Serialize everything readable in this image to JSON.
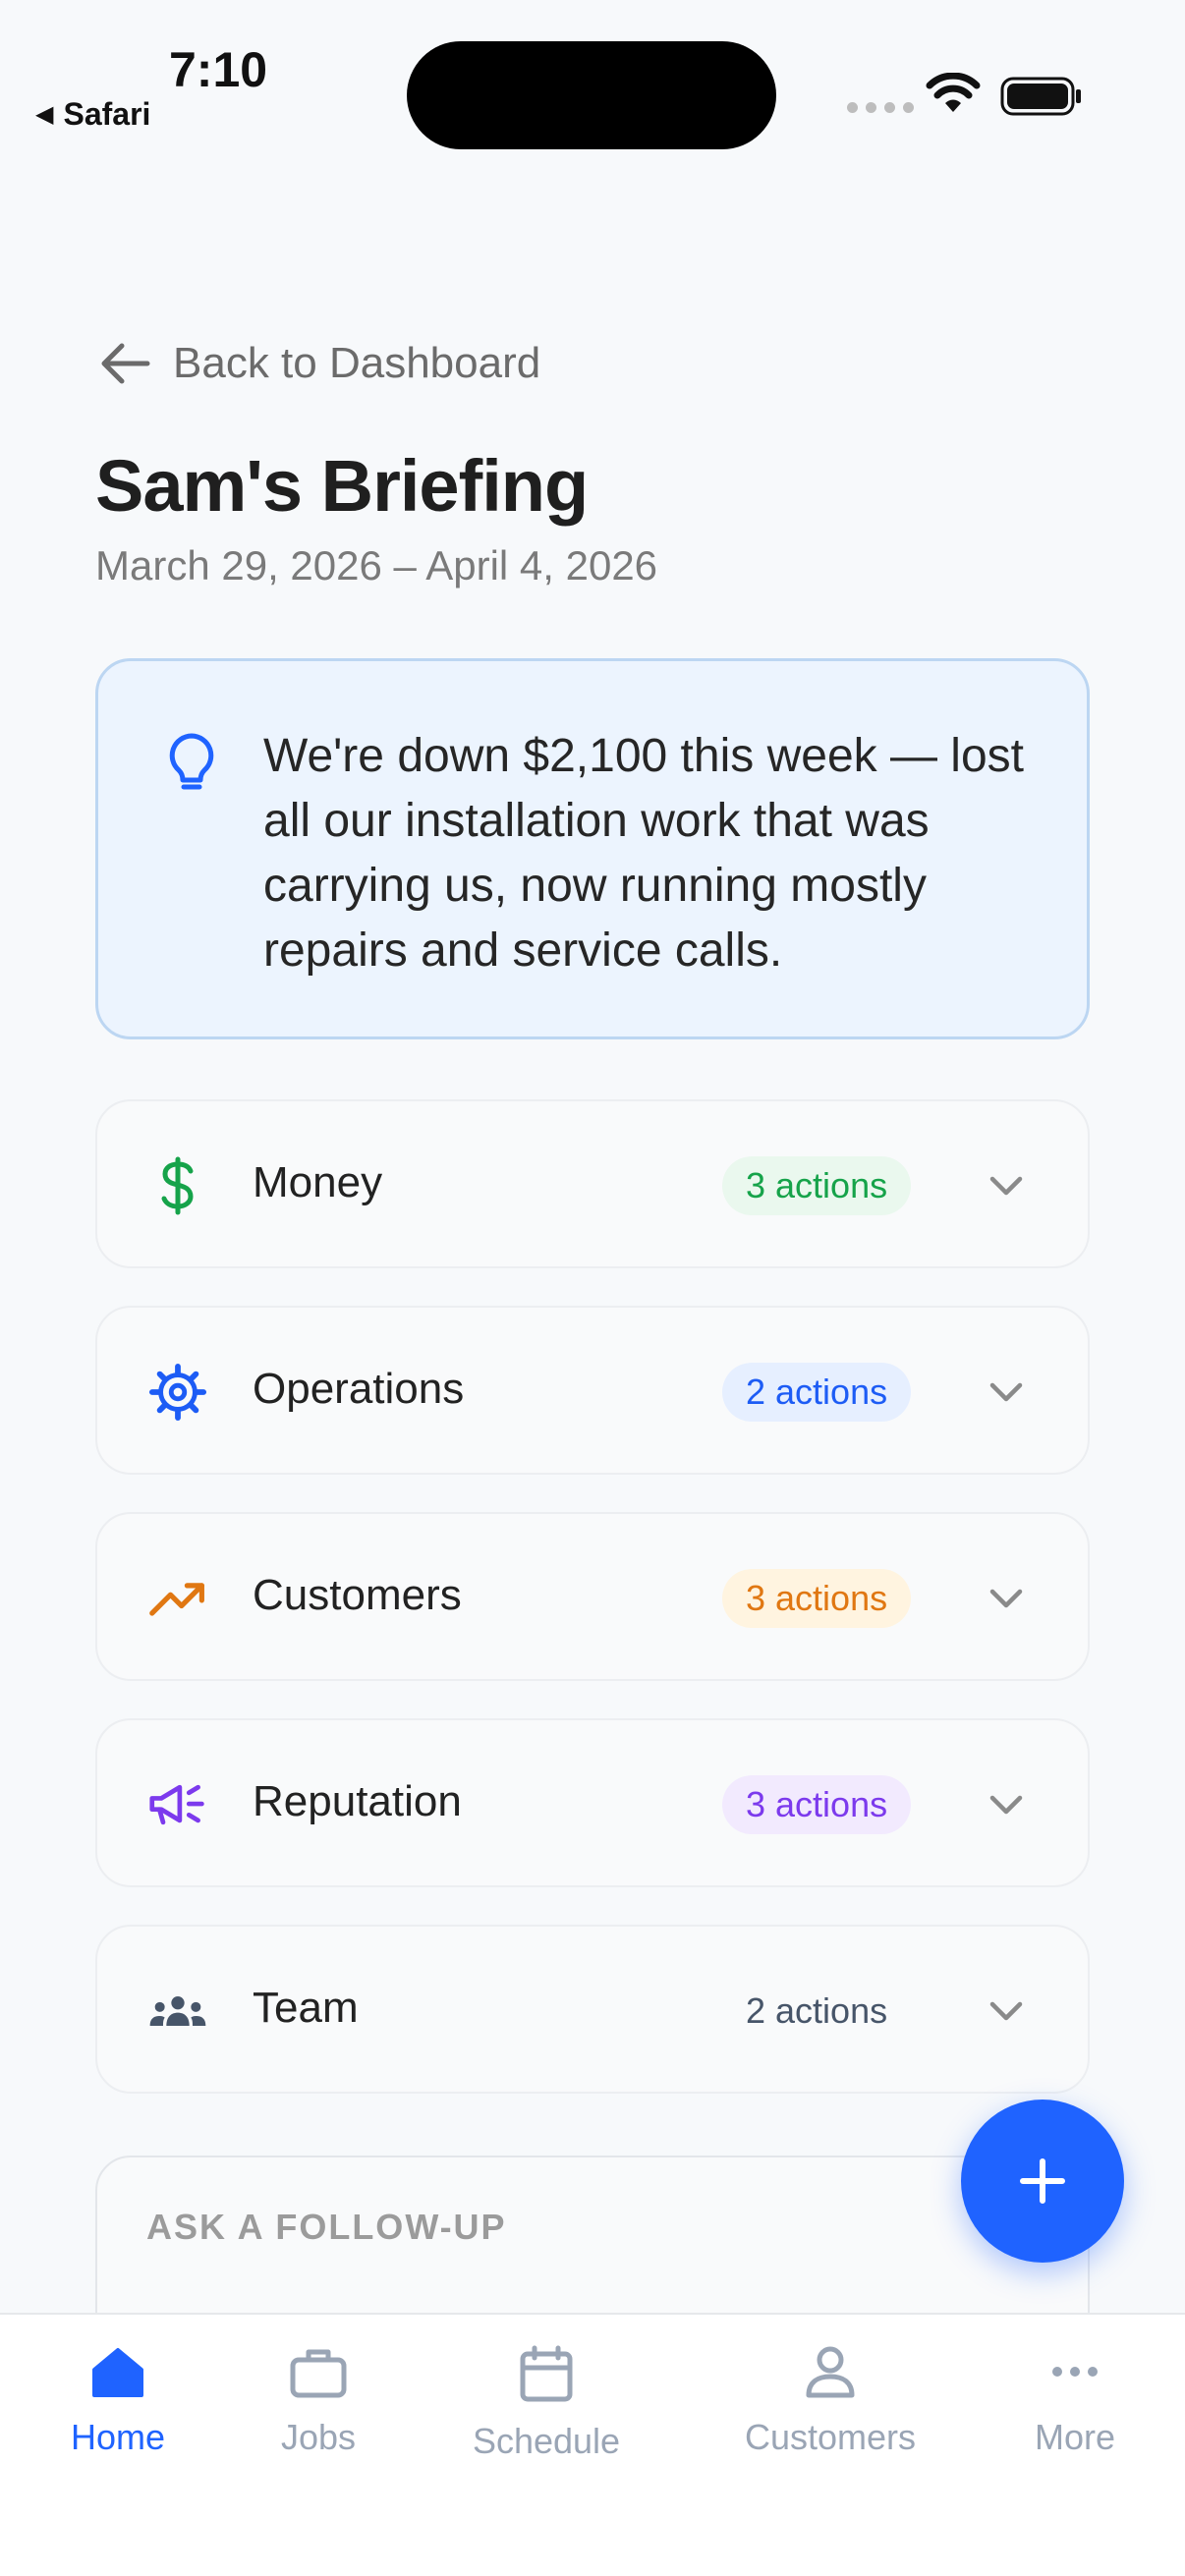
{
  "status_bar": {
    "time": "7:10",
    "back_app": "Safari"
  },
  "nav": {
    "back_label": "Back to Dashboard"
  },
  "header": {
    "title": "Sam's Briefing",
    "date_range": "March 29, 2026 – April 4, 2026"
  },
  "insight": {
    "icon": "lightbulb-icon",
    "text": "We're down $2,100 this week — lost all our installation work that was carrying us, now running mostly repairs and service calls."
  },
  "categories": [
    {
      "label": "Money",
      "actions": "3 actions",
      "icon": "dollar-icon",
      "color": "#16a34a",
      "badge_bg": "#eaf8ee"
    },
    {
      "label": "Operations",
      "actions": "2 actions",
      "icon": "gear-icon",
      "color": "#1d5cf5",
      "badge_bg": "#e6efff"
    },
    {
      "label": "Customers",
      "actions": "3 actions",
      "icon": "trending-up-icon",
      "color": "#e07712",
      "badge_bg": "#fff4e0"
    },
    {
      "label": "Reputation",
      "actions": "3 actions",
      "icon": "megaphone-icon",
      "color": "#7c3aed",
      "badge_bg": "#f2eafe"
    },
    {
      "label": "Team",
      "actions": "2 actions",
      "icon": "team-icon",
      "color": "#475569",
      "badge_bg": "transparent"
    }
  ],
  "followup": {
    "label": "ASK A FOLLOW-UP"
  },
  "fab": {
    "icon": "plus-icon"
  },
  "tabs": [
    {
      "label": "Home",
      "icon": "home-icon",
      "active": true
    },
    {
      "label": "Jobs",
      "icon": "briefcase-icon",
      "active": false
    },
    {
      "label": "Schedule",
      "icon": "calendar-icon",
      "active": false
    },
    {
      "label": "Customers",
      "icon": "person-icon",
      "active": false
    },
    {
      "label": "More",
      "icon": "more-icon",
      "active": false
    }
  ],
  "colors": {
    "accent": "#1f63ff",
    "insight_bg": "#ecf4fe",
    "insight_border": "#bcd6f2"
  }
}
